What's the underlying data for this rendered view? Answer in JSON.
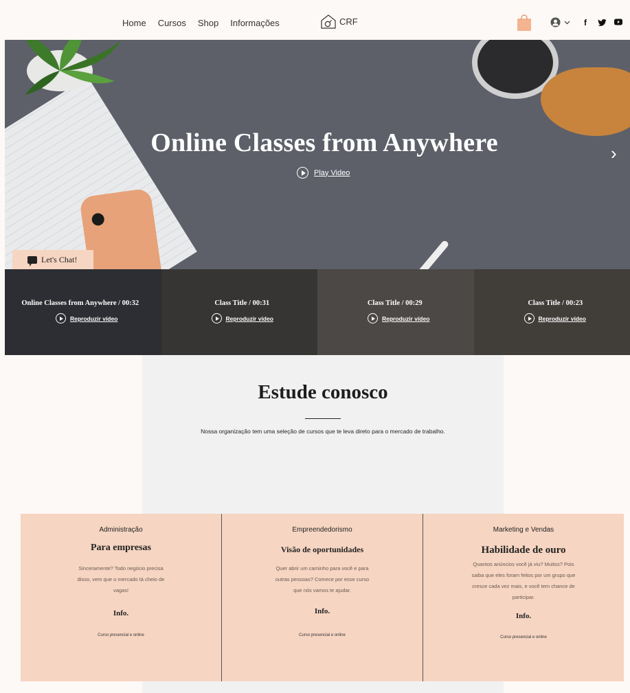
{
  "header": {
    "nav": [
      "Home",
      "Cursos",
      "Shop",
      "Informações"
    ],
    "logo_text": "CRF",
    "social": [
      "f",
      "y",
      "▶"
    ]
  },
  "hero": {
    "title": "Online Classes from Anywhere",
    "play_label": "Play Video",
    "chat_label": "Let's Chat!",
    "colors": {
      "background": "#5d6069",
      "accent": "#f6d5c2"
    }
  },
  "videos": [
    {
      "title": "Online Classes from Anywhere / 00:32",
      "play_label": "Reproduzir vídeo"
    },
    {
      "title": "Class Title / 00:31",
      "play_label": "Reproduzir vídeo"
    },
    {
      "title": "Class Title / 00:29",
      "play_label": "Reproduzir vídeo"
    },
    {
      "title": "Class Title / 00:23",
      "play_label": "Reproduzir vídeo"
    }
  ],
  "study": {
    "title": "Estude conosco",
    "subtitle": "Nossa organização tem uma seleção de cursos que te leva direto para o mercado de trabalho."
  },
  "cards": [
    {
      "category": "Administração",
      "title": "Para empresas",
      "text": [
        "Sinceramente? Todo negócio precisa",
        "disso, vem que o mercado tá cheio de",
        "vagas!"
      ],
      "info": "Info.",
      "footer": "Curso presencial e online"
    },
    {
      "category": "Empreendedorismo",
      "title": "Visão de oportunidades",
      "text": [
        "Quer abrir um caminho para você e para",
        "outras pessoas? Comece por esse curso",
        "que nós vamos te ajudar."
      ],
      "info": "Info.",
      "footer": "Curso presencial e online"
    },
    {
      "category": "Marketing e Vendas",
      "title": "Habilidade de ouro",
      "text": [
        "Quantos anúncios você já viu? Muitos? Pois",
        "saiba que eles foram feitos por um grupo que",
        "cresce cada vez mais, e você tem chance de",
        "participar."
      ],
      "info": "Info.",
      "footer": "Curso presencial e online"
    }
  ]
}
